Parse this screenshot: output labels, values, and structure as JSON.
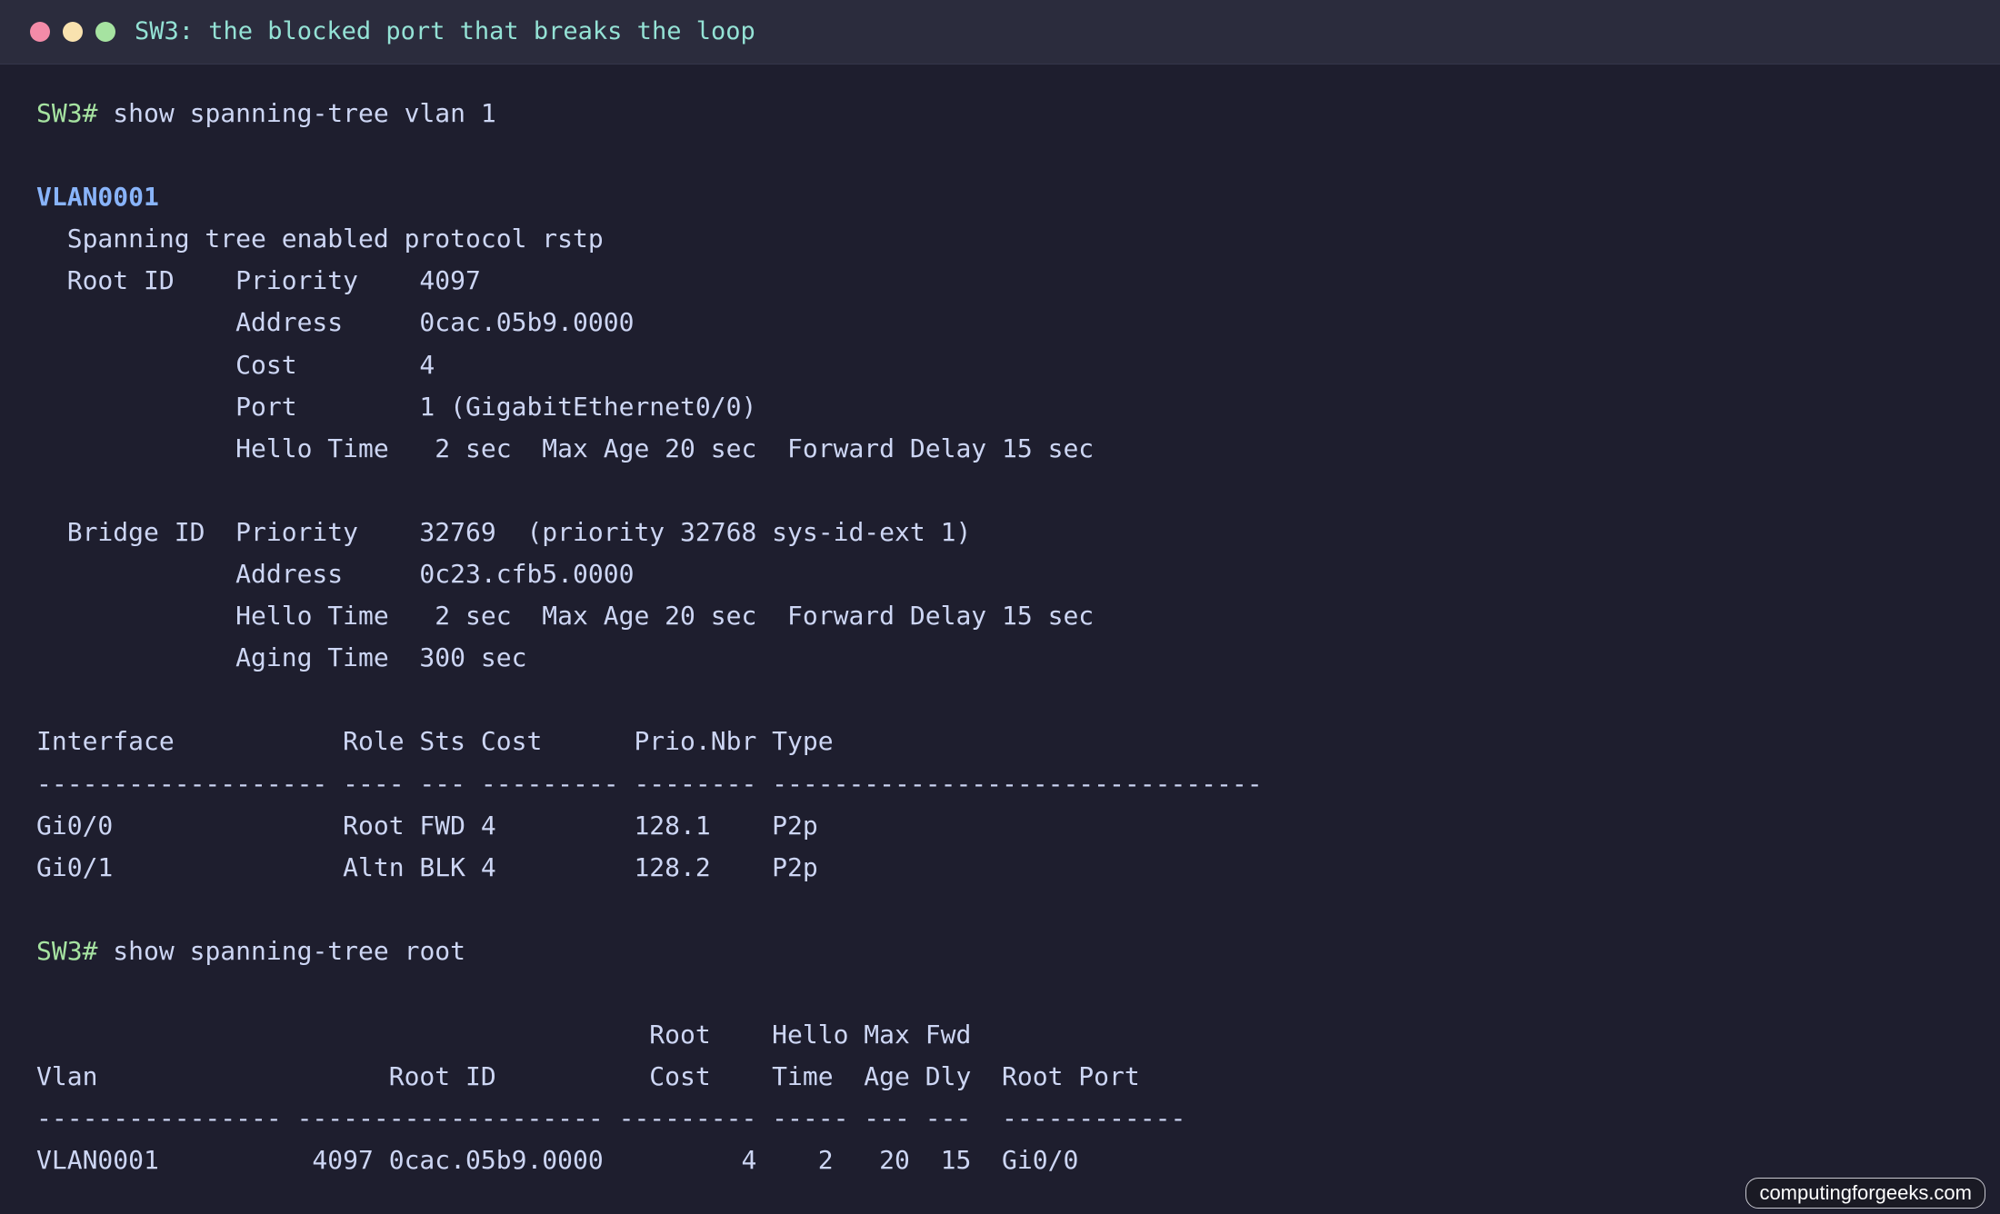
{
  "window": {
    "title": "SW3: the blocked port that breaks the loop"
  },
  "terminal": {
    "lines": [
      {
        "prompt": "SW3#",
        "text": " show spanning-tree vlan 1"
      },
      {
        "text": ""
      },
      {
        "vlan": "VLAN0001"
      },
      {
        "text": "  Spanning tree enabled protocol rstp"
      },
      {
        "text": "  Root ID    Priority    4097"
      },
      {
        "text": "             Address     0cac.05b9.0000"
      },
      {
        "text": "             Cost        4"
      },
      {
        "text": "             Port        1 (GigabitEthernet0/0)"
      },
      {
        "text": "             Hello Time   2 sec  Max Age 20 sec  Forward Delay 15 sec"
      },
      {
        "text": ""
      },
      {
        "text": "  Bridge ID  Priority    32769  (priority 32768 sys-id-ext 1)"
      },
      {
        "text": "             Address     0c23.cfb5.0000"
      },
      {
        "text": "             Hello Time   2 sec  Max Age 20 sec  Forward Delay 15 sec"
      },
      {
        "text": "             Aging Time  300 sec"
      },
      {
        "text": ""
      },
      {
        "text": "Interface           Role Sts Cost      Prio.Nbr Type"
      },
      {
        "text": "------------------- ---- --- --------- -------- --------------------------------"
      },
      {
        "text": "Gi0/0               Root FWD 4         128.1    P2p"
      },
      {
        "text": "Gi0/1               Altn BLK 4         128.2    P2p"
      },
      {
        "text": ""
      },
      {
        "prompt": "SW3#",
        "text": " show spanning-tree root"
      },
      {
        "text": ""
      },
      {
        "text": "                                        Root    Hello Max Fwd"
      },
      {
        "text": "Vlan                   Root ID          Cost    Time  Age Dly  Root Port"
      },
      {
        "text": "---------------- -------------------- --------- ----- --- ---  ------------"
      },
      {
        "text": "VLAN0001          4097 0cac.05b9.0000         4    2   20  15  Gi0/0"
      }
    ]
  },
  "watermark": {
    "text": "computingforgeeks.com"
  }
}
